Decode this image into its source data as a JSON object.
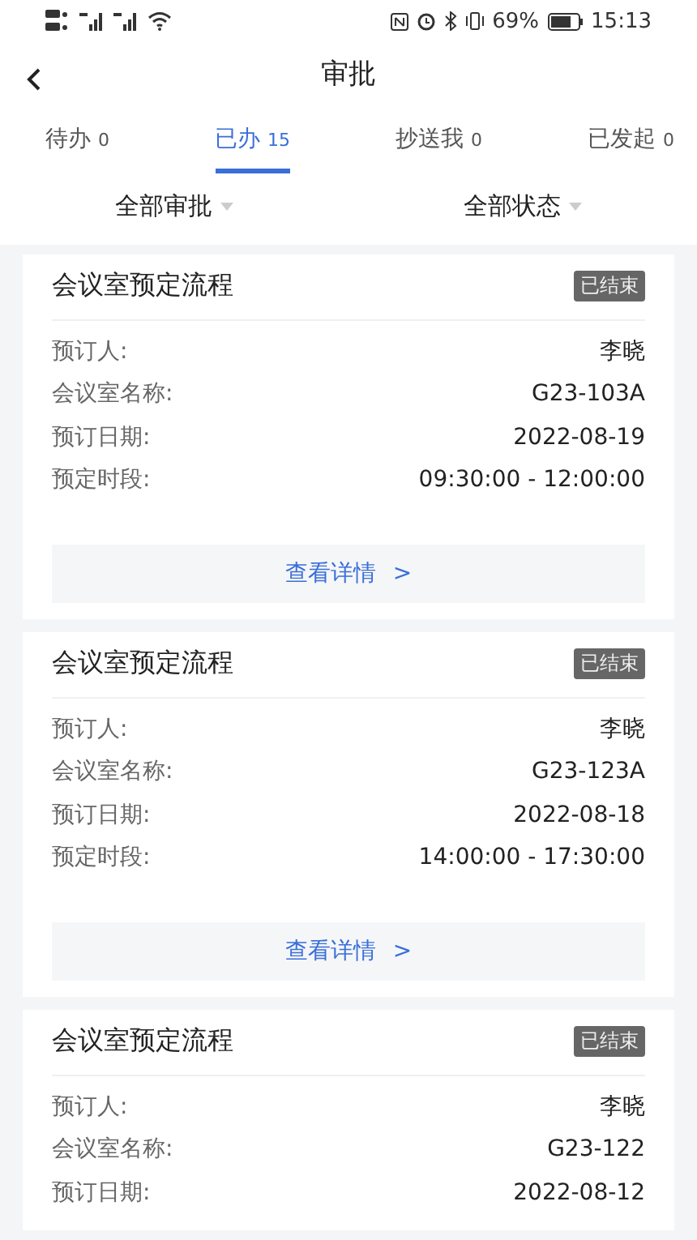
{
  "status_bar": {
    "battery_text": "69%",
    "time": "15:13"
  },
  "nav": {
    "title": "审批"
  },
  "tabs": [
    {
      "label": "待办",
      "count": "0",
      "selected": false
    },
    {
      "label": "已办",
      "count": "15",
      "selected": true
    },
    {
      "label": "抄送我",
      "count": "0",
      "selected": false
    },
    {
      "label": "已发起",
      "count": "0",
      "selected": false
    }
  ],
  "filters": [
    "全部审批",
    "全部状态"
  ],
  "cards": [
    {
      "title": "会议室预定流程",
      "status": "已结束",
      "rows": [
        {
          "label": "预订人:",
          "value": "李晓"
        },
        {
          "label": "会议室名称:",
          "value": "G23-103A"
        },
        {
          "label": "预订日期:",
          "value": "2022-08-19"
        },
        {
          "label": "预定时段:",
          "value": "09:30:00 - 12:00:00"
        }
      ],
      "action": "查看详情",
      "action_arrow": ">"
    },
    {
      "title": "会议室预定流程",
      "status": "已结束",
      "rows": [
        {
          "label": "预订人:",
          "value": "李晓"
        },
        {
          "label": "会议室名称:",
          "value": "G23-123A"
        },
        {
          "label": "预订日期:",
          "value": "2022-08-18"
        },
        {
          "label": "预定时段:",
          "value": "14:00:00 - 17:30:00"
        }
      ],
      "action": "查看详情",
      "action_arrow": ">"
    },
    {
      "title": "会议室预定流程",
      "status": "已结束",
      "rows": [
        {
          "label": "预订人:",
          "value": "李晓"
        },
        {
          "label": "会议室名称:",
          "value": "G23-122"
        },
        {
          "label": "预订日期:",
          "value": "2022-08-12"
        }
      ]
    }
  ]
}
